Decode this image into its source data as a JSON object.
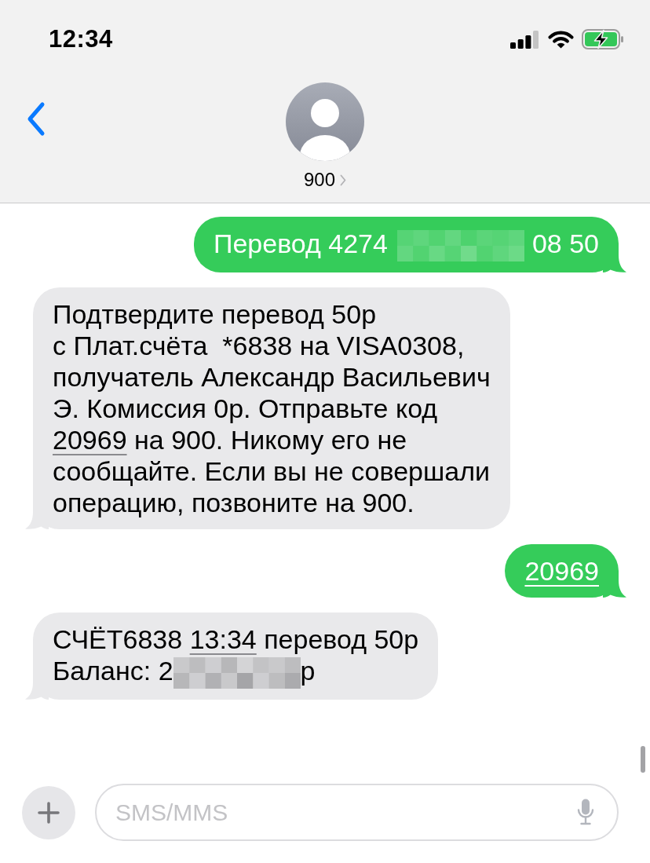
{
  "status_bar": {
    "time": "12:34"
  },
  "header": {
    "contact": "900"
  },
  "messages": [
    {
      "kind": "sent",
      "lines": [
        [
          {
            "kind": "text",
            "text": "Перевод 4274"
          },
          {
            "kind": "redacted"
          },
          {
            "kind": "text",
            "text": "08 50"
          }
        ]
      ]
    },
    {
      "kind": "received",
      "lines": [
        [
          {
            "kind": "text",
            "text": "Подтвердите перевод 50р"
          }
        ],
        [
          {
            "kind": "text",
            "text": "с Плат.счёта  *6838 на VISA0308,"
          }
        ],
        [
          {
            "kind": "text",
            "text": "получатель Александр Васильевич"
          }
        ],
        [
          {
            "kind": "text",
            "text": "Э. Комиссия 0р. Отправьте код"
          }
        ],
        [
          {
            "kind": "link",
            "text": "20969"
          },
          {
            "kind": "text",
            "text": " на 900. Никому его не"
          }
        ],
        [
          {
            "kind": "text",
            "text": "сообщайте. Если вы не совершали"
          }
        ],
        [
          {
            "kind": "text",
            "text": "операцию, позвоните на 900."
          }
        ]
      ]
    },
    {
      "kind": "sent",
      "lines": [
        [
          {
            "kind": "link",
            "text": "20969"
          }
        ]
      ]
    },
    {
      "kind": "received",
      "lines": [
        [
          {
            "kind": "text",
            "text": "СЧЁТ6838 "
          },
          {
            "kind": "link",
            "text": "13:34"
          },
          {
            "kind": "text",
            "text": " перевод 50р"
          }
        ],
        [
          {
            "kind": "text",
            "text": "Баланс: 2"
          },
          {
            "kind": "redacted"
          },
          {
            "kind": "text",
            "text": "р"
          }
        ]
      ]
    }
  ],
  "composer": {
    "placeholder": "SMS/MMS"
  }
}
